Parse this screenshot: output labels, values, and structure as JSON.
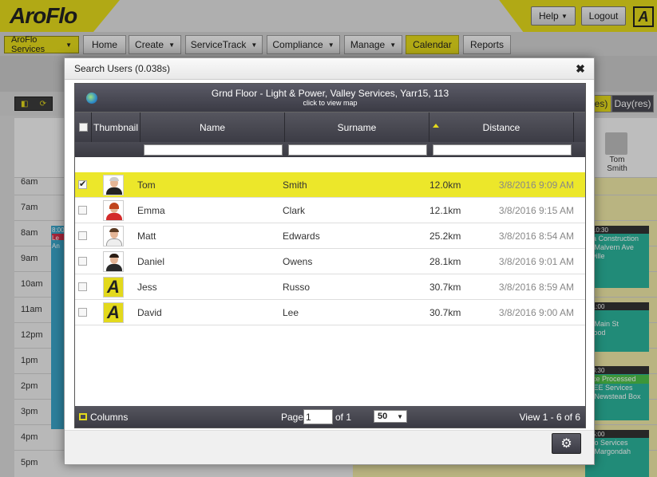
{
  "app": {
    "logo": "AroFlo",
    "help_label": "Help",
    "logout_label": "Logout",
    "badge_letter": "A"
  },
  "nav": {
    "services_label": "AroFlo Services",
    "items": [
      "Home",
      "Create",
      "ServiceTrack",
      "Compliance",
      "Manage",
      "Calendar",
      "Reports"
    ]
  },
  "calendar": {
    "view_buttons": [
      "res)",
      "Day(res)"
    ],
    "times": [
      "6am",
      "7am",
      "8am",
      "9am",
      "10am",
      "11am",
      "12pm",
      "1pm",
      "2pm",
      "3pm",
      "4pm",
      "5pm"
    ],
    "resource_name": "Tom Smith",
    "left_event": {
      "time": "8:00",
      "text": "Le",
      "sub": "An"
    },
    "events": [
      {
        "time": "- 10:30",
        "line1": "da Construction",
        "line2": "2 Malvern Ave",
        "line3": "eville"
      },
      {
        "time": "- 1:00",
        "line1": "R",
        "line2": "1 Main St",
        "line3": "wood"
      },
      {
        "time": "- 3:30",
        "status": "nce Processed",
        "line1": "CEE Services",
        "line2": "2 Newstead Box",
        "line3": ""
      },
      {
        "time": "- 5:00",
        "line1": "Flo Services",
        "line2": "2 Margondah",
        "line3": ""
      }
    ]
  },
  "modal": {
    "title": "Search Users (0.038s)",
    "caption_title": "Grnd Floor - Light & Power, Valley Services, Yarr15, 113",
    "caption_sub": "click to view map",
    "columns": [
      "Thumbnail",
      "Name",
      "Surname",
      "Distance"
    ],
    "rows": [
      {
        "name": "Tom",
        "surname": "Smith",
        "distance": "12.0km",
        "timestamp": "3/8/2016 9:09 AM",
        "selected": true,
        "thumb": "photo-tom"
      },
      {
        "name": "Emma",
        "surname": "Clark",
        "distance": "12.1km",
        "timestamp": "3/8/2016 9:15 AM",
        "selected": false,
        "thumb": "photo-emma"
      },
      {
        "name": "Matt",
        "surname": "Edwards",
        "distance": "25.2km",
        "timestamp": "3/8/2016 8:54 AM",
        "selected": false,
        "thumb": "photo-matt"
      },
      {
        "name": "Daniel",
        "surname": "Owens",
        "distance": "28.1km",
        "timestamp": "3/8/2016 9:01 AM",
        "selected": false,
        "thumb": "photo-daniel"
      },
      {
        "name": "Jess",
        "surname": "Russo",
        "distance": "30.7km",
        "timestamp": "3/8/2016 8:59 AM",
        "selected": false,
        "thumb": "aroflo-logo"
      },
      {
        "name": "David",
        "surname": "Lee",
        "distance": "30.7km",
        "timestamp": "3/8/2016 9:00 AM",
        "selected": false,
        "thumb": "aroflo-logo"
      }
    ],
    "footer": {
      "columns_label": "Columns",
      "page_label": "Page",
      "page_value": "1",
      "of_label": "of 1",
      "per_page": "50",
      "view_label": "View 1 - 6 of 6"
    }
  },
  "colors": {
    "brand_yellow": "#e3d91c",
    "grid_dark": "#3c3c45",
    "selected_row": "#ece72a"
  }
}
